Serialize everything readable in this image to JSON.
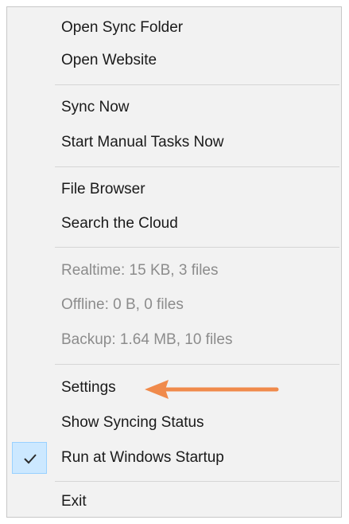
{
  "menu": {
    "groups": [
      {
        "items": [
          {
            "label": "Open Sync Folder",
            "enabled": true
          },
          {
            "label": "Open Website",
            "enabled": true
          }
        ]
      },
      {
        "items": [
          {
            "label": "Sync Now",
            "enabled": true
          },
          {
            "label": "Start Manual Tasks Now",
            "enabled": true
          }
        ]
      },
      {
        "items": [
          {
            "label": "File Browser",
            "enabled": true
          },
          {
            "label": "Search the Cloud",
            "enabled": true
          }
        ]
      },
      {
        "items": [
          {
            "label": "Realtime: 15 KB, 3 files",
            "enabled": false
          },
          {
            "label": "Offline: 0 B, 0 files",
            "enabled": false
          },
          {
            "label": "Backup: 1.64 MB, 10 files",
            "enabled": false
          }
        ]
      },
      {
        "items": [
          {
            "label": "Settings",
            "enabled": true
          },
          {
            "label": "Show Syncing Status",
            "enabled": true
          },
          {
            "label": "Run at Windows Startup",
            "enabled": true,
            "checked": true
          }
        ]
      },
      {
        "items": [
          {
            "label": "Exit",
            "enabled": true
          }
        ]
      }
    ]
  },
  "annotation": {
    "arrow_color": "#f08a4b",
    "points_to": "Settings"
  },
  "colors": {
    "menu_background": "#f2f2f2",
    "check_highlight": "#cce8ff",
    "disabled_text": "#8c8c8c"
  }
}
